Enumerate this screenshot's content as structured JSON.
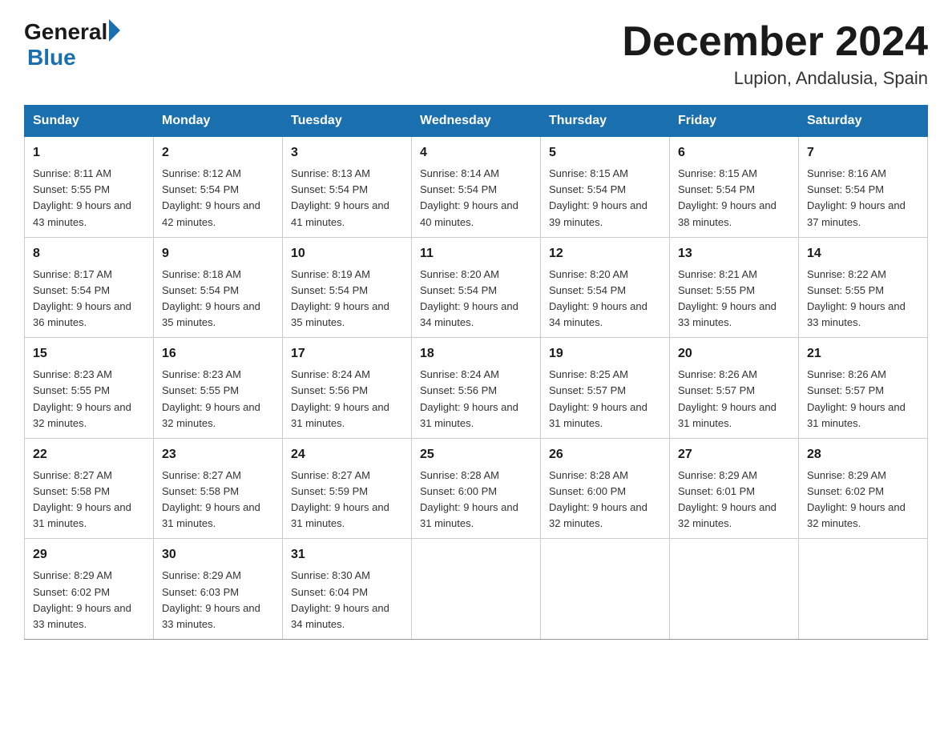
{
  "logo": {
    "general": "General",
    "blue": "Blue"
  },
  "header": {
    "month": "December 2024",
    "location": "Lupion, Andalusia, Spain"
  },
  "days_of_week": [
    "Sunday",
    "Monday",
    "Tuesday",
    "Wednesday",
    "Thursday",
    "Friday",
    "Saturday"
  ],
  "weeks": [
    [
      {
        "day": "1",
        "sunrise": "8:11 AM",
        "sunset": "5:55 PM",
        "daylight": "9 hours and 43 minutes."
      },
      {
        "day": "2",
        "sunrise": "8:12 AM",
        "sunset": "5:54 PM",
        "daylight": "9 hours and 42 minutes."
      },
      {
        "day": "3",
        "sunrise": "8:13 AM",
        "sunset": "5:54 PM",
        "daylight": "9 hours and 41 minutes."
      },
      {
        "day": "4",
        "sunrise": "8:14 AM",
        "sunset": "5:54 PM",
        "daylight": "9 hours and 40 minutes."
      },
      {
        "day": "5",
        "sunrise": "8:15 AM",
        "sunset": "5:54 PM",
        "daylight": "9 hours and 39 minutes."
      },
      {
        "day": "6",
        "sunrise": "8:15 AM",
        "sunset": "5:54 PM",
        "daylight": "9 hours and 38 minutes."
      },
      {
        "day": "7",
        "sunrise": "8:16 AM",
        "sunset": "5:54 PM",
        "daylight": "9 hours and 37 minutes."
      }
    ],
    [
      {
        "day": "8",
        "sunrise": "8:17 AM",
        "sunset": "5:54 PM",
        "daylight": "9 hours and 36 minutes."
      },
      {
        "day": "9",
        "sunrise": "8:18 AM",
        "sunset": "5:54 PM",
        "daylight": "9 hours and 35 minutes."
      },
      {
        "day": "10",
        "sunrise": "8:19 AM",
        "sunset": "5:54 PM",
        "daylight": "9 hours and 35 minutes."
      },
      {
        "day": "11",
        "sunrise": "8:20 AM",
        "sunset": "5:54 PM",
        "daylight": "9 hours and 34 minutes."
      },
      {
        "day": "12",
        "sunrise": "8:20 AM",
        "sunset": "5:54 PM",
        "daylight": "9 hours and 34 minutes."
      },
      {
        "day": "13",
        "sunrise": "8:21 AM",
        "sunset": "5:55 PM",
        "daylight": "9 hours and 33 minutes."
      },
      {
        "day": "14",
        "sunrise": "8:22 AM",
        "sunset": "5:55 PM",
        "daylight": "9 hours and 33 minutes."
      }
    ],
    [
      {
        "day": "15",
        "sunrise": "8:23 AM",
        "sunset": "5:55 PM",
        "daylight": "9 hours and 32 minutes."
      },
      {
        "day": "16",
        "sunrise": "8:23 AM",
        "sunset": "5:55 PM",
        "daylight": "9 hours and 32 minutes."
      },
      {
        "day": "17",
        "sunrise": "8:24 AM",
        "sunset": "5:56 PM",
        "daylight": "9 hours and 31 minutes."
      },
      {
        "day": "18",
        "sunrise": "8:24 AM",
        "sunset": "5:56 PM",
        "daylight": "9 hours and 31 minutes."
      },
      {
        "day": "19",
        "sunrise": "8:25 AM",
        "sunset": "5:57 PM",
        "daylight": "9 hours and 31 minutes."
      },
      {
        "day": "20",
        "sunrise": "8:26 AM",
        "sunset": "5:57 PM",
        "daylight": "9 hours and 31 minutes."
      },
      {
        "day": "21",
        "sunrise": "8:26 AM",
        "sunset": "5:57 PM",
        "daylight": "9 hours and 31 minutes."
      }
    ],
    [
      {
        "day": "22",
        "sunrise": "8:27 AM",
        "sunset": "5:58 PM",
        "daylight": "9 hours and 31 minutes."
      },
      {
        "day": "23",
        "sunrise": "8:27 AM",
        "sunset": "5:58 PM",
        "daylight": "9 hours and 31 minutes."
      },
      {
        "day": "24",
        "sunrise": "8:27 AM",
        "sunset": "5:59 PM",
        "daylight": "9 hours and 31 minutes."
      },
      {
        "day": "25",
        "sunrise": "8:28 AM",
        "sunset": "6:00 PM",
        "daylight": "9 hours and 31 minutes."
      },
      {
        "day": "26",
        "sunrise": "8:28 AM",
        "sunset": "6:00 PM",
        "daylight": "9 hours and 32 minutes."
      },
      {
        "day": "27",
        "sunrise": "8:29 AM",
        "sunset": "6:01 PM",
        "daylight": "9 hours and 32 minutes."
      },
      {
        "day": "28",
        "sunrise": "8:29 AM",
        "sunset": "6:02 PM",
        "daylight": "9 hours and 32 minutes."
      }
    ],
    [
      {
        "day": "29",
        "sunrise": "8:29 AM",
        "sunset": "6:02 PM",
        "daylight": "9 hours and 33 minutes."
      },
      {
        "day": "30",
        "sunrise": "8:29 AM",
        "sunset": "6:03 PM",
        "daylight": "9 hours and 33 minutes."
      },
      {
        "day": "31",
        "sunrise": "8:30 AM",
        "sunset": "6:04 PM",
        "daylight": "9 hours and 34 minutes."
      },
      null,
      null,
      null,
      null
    ]
  ]
}
